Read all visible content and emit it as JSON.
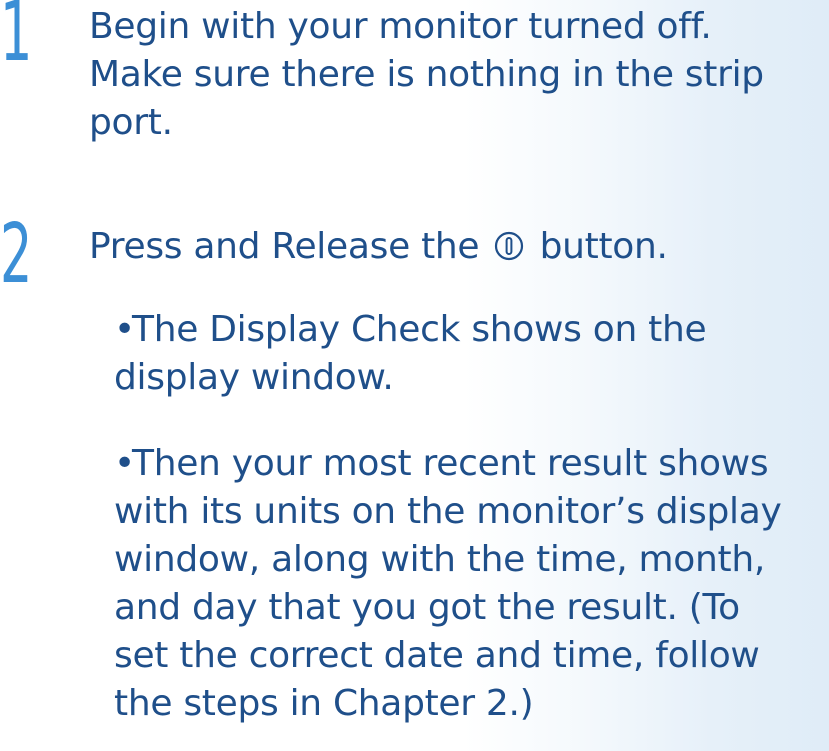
{
  "steps": [
    {
      "number": "1",
      "lines": [
        "Begin with your monitor turned off.",
        "Make sure there is nothing in the strip",
        "port."
      ]
    },
    {
      "number": "2",
      "text_before_icon": "Press and Release the",
      "icon": "power-button-icon",
      "text_after_icon": "button.",
      "bullets": [
        {
          "marker": "•",
          "lines": [
            "The Display Check shows on the",
            "display window."
          ]
        },
        {
          "marker": "•",
          "lines": [
            "Then your most recent result shows",
            "with its units on the monitor’s display",
            "window, along with the time, month,",
            "and day that you got the result. (To",
            "set the correct date and time, follow",
            "the steps in Chapter 2.)"
          ]
        }
      ]
    }
  ],
  "colors": {
    "text": "#1f4f8a",
    "step_number": "#3c8fd6",
    "sidebar_tint": "#dfecf7"
  }
}
